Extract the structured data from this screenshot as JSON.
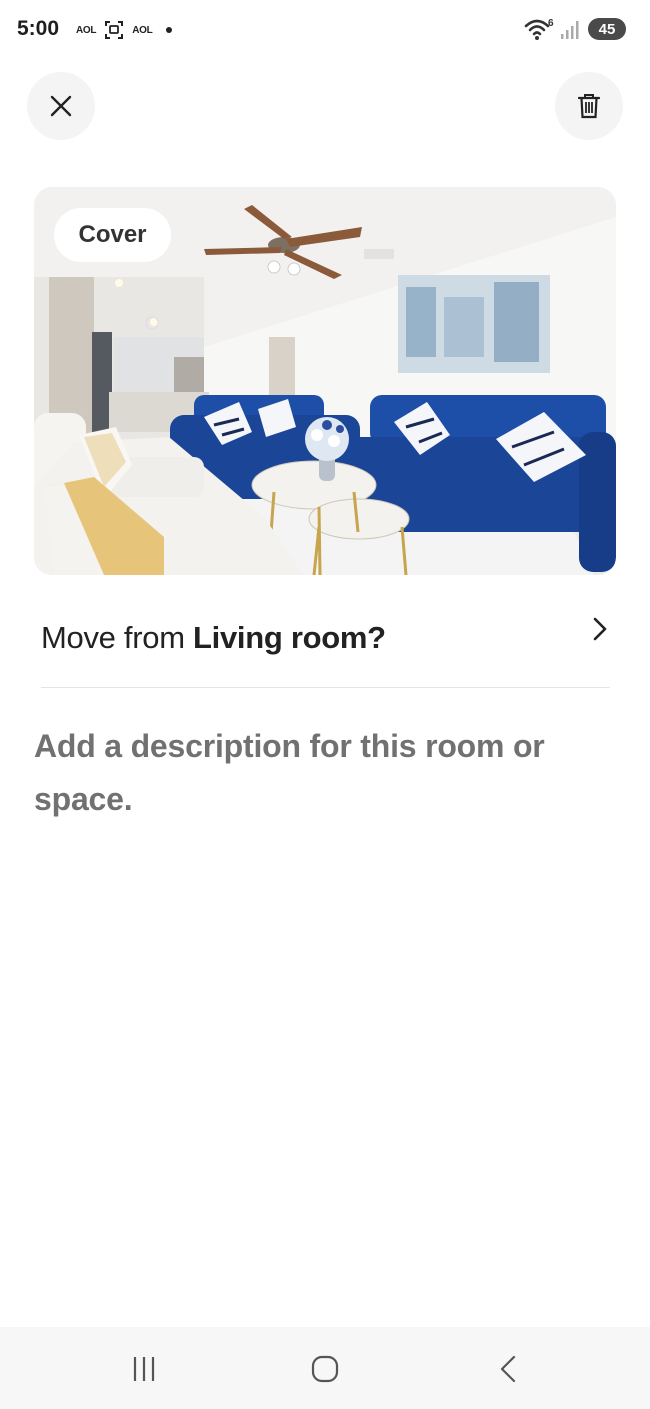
{
  "status_bar": {
    "time": "5:00",
    "carrier1": "AOL",
    "carrier2": "AOL",
    "wifi_badge": "6",
    "battery": "45"
  },
  "toolbar": {
    "close_icon": "close-icon",
    "delete_icon": "trash-icon"
  },
  "photo": {
    "badge": "Cover",
    "subject": "living room with blue sectional sofa"
  },
  "move": {
    "prefix": "Move from ",
    "room": "Living room?"
  },
  "description": {
    "placeholder": "Add a description for this room or space."
  },
  "nav": {
    "recent_icon": "recent-apps-icon",
    "home_icon": "home-icon",
    "back_icon": "back-icon"
  },
  "colors": {
    "sofa_blue": "#1e4fa8",
    "text_primary": "#222222",
    "text_muted": "#717171",
    "button_bg": "#f4f4f4"
  }
}
